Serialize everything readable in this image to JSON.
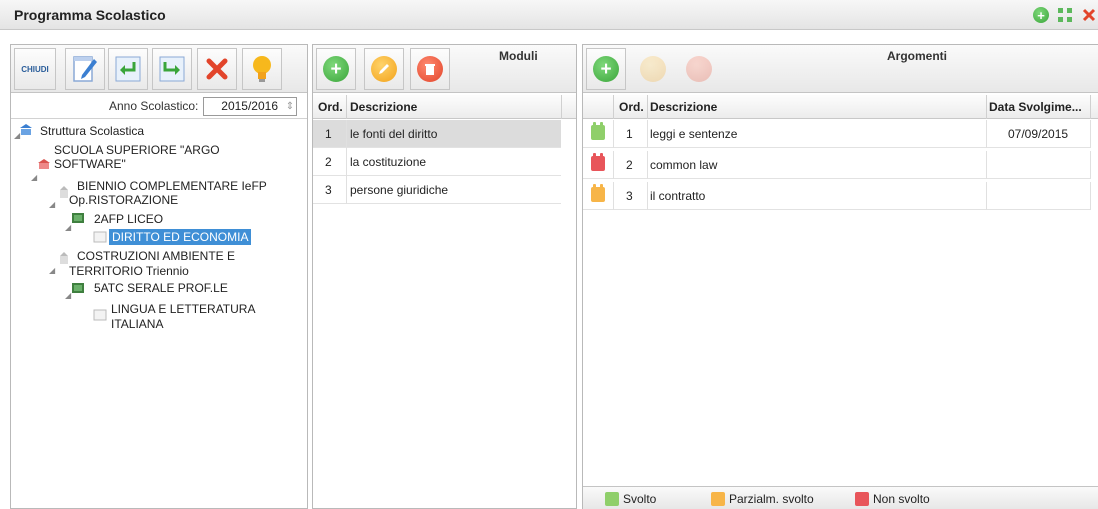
{
  "window": {
    "title": "Programma Scolastico",
    "controls": [
      "add-icon",
      "expand-icon",
      "close-icon"
    ]
  },
  "left": {
    "toolbar": {
      "close_label": "CHIUDI",
      "buttons": [
        "edit-icon",
        "enter-icon",
        "export-icon",
        "delete-icon",
        "lightbulb-icon"
      ]
    },
    "year_label": "Anno Scolastico:",
    "year_value": "2015/2016",
    "tree": [
      {
        "label": "Struttura Scolastica"
      },
      {
        "label": "SCUOLA SUPERIORE \"ARGO"
      },
      {
        "label": "SOFTWARE\""
      },
      {
        "label": "BIENNIO COMPLEMENTARE IeFP"
      },
      {
        "label": "Op.RISTORAZIONE"
      },
      {
        "label": "2AFP LICEO"
      },
      {
        "label": "DIRITTO ED ECONOMIA"
      },
      {
        "label": "COSTRUZIONI AMBIENTE E"
      },
      {
        "label": "TERRITORIO Triennio"
      },
      {
        "label": "5ATC SERALE PROF.LE"
      },
      {
        "label": "LINGUA E LETTERATURA"
      },
      {
        "label": "ITALIANA"
      }
    ]
  },
  "moduli": {
    "title": "Moduli",
    "columns": {
      "ord": "Ord.",
      "desc": "Descrizione"
    },
    "rows": [
      {
        "ord": "1",
        "desc": "le fonti del diritto"
      },
      {
        "ord": "2",
        "desc": "la costituzione"
      },
      {
        "ord": "3",
        "desc": "persone giuridiche"
      }
    ]
  },
  "argomenti": {
    "title": "Argomenti",
    "columns": {
      "ord": "Ord.",
      "desc": "Descrizione",
      "date": "Data Svolgime..."
    },
    "rows": [
      {
        "status": "green",
        "ord": "1",
        "desc": "leggi e sentenze",
        "date": "07/09/2015"
      },
      {
        "status": "red",
        "ord": "2",
        "desc": "common law",
        "date": ""
      },
      {
        "status": "orange",
        "ord": "3",
        "desc": "il contratto",
        "date": ""
      }
    ],
    "legend": {
      "done": "Svolto",
      "partial": "Parzialm. svolto",
      "not_done": "Non svolto"
    }
  },
  "colors": {
    "done": "#8fcf6a",
    "partial": "#f7b548",
    "not_done": "#e8555a",
    "selection": "#3f8fd6"
  }
}
